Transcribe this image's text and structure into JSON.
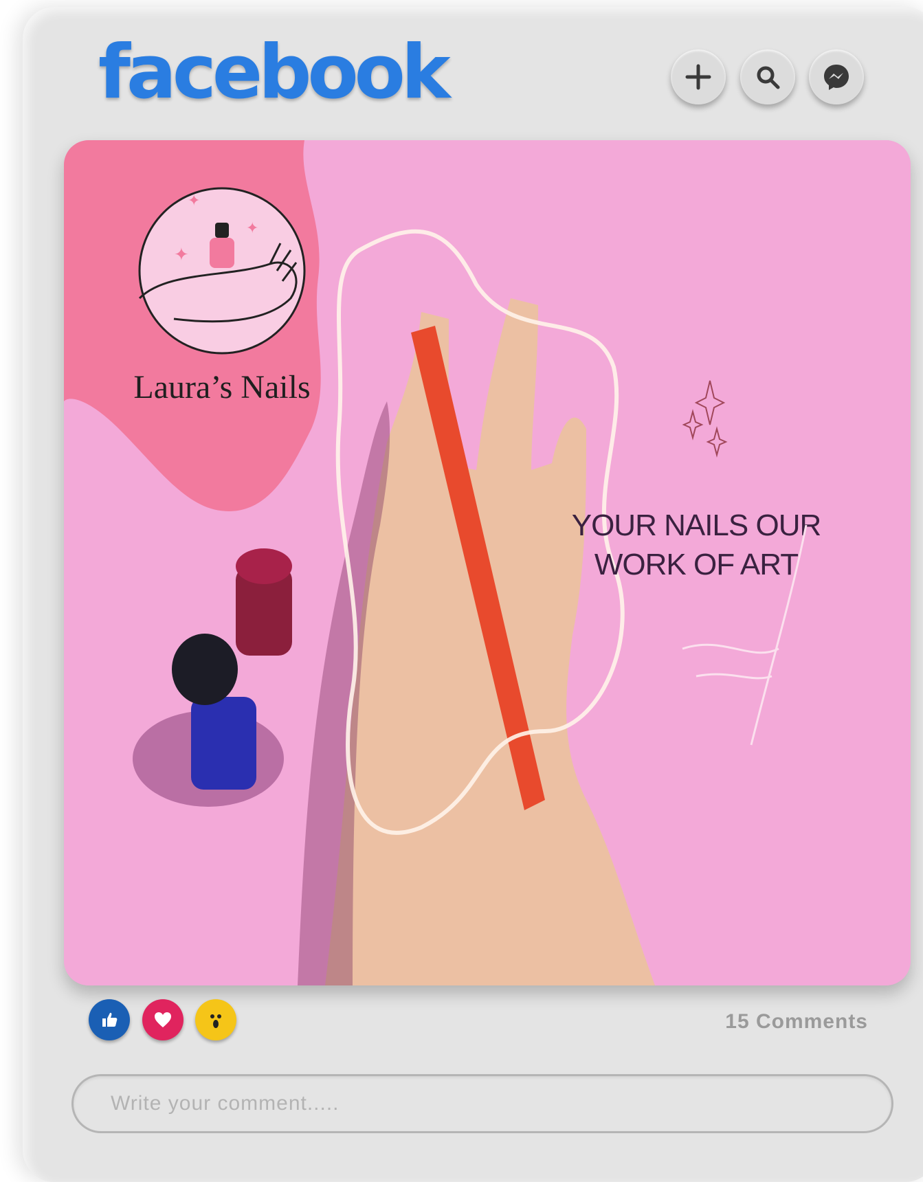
{
  "app": {
    "brand": "facebook",
    "brand_color": "#2a7de1"
  },
  "header": {
    "buttons": [
      {
        "icon": "plus-icon"
      },
      {
        "icon": "search-icon"
      },
      {
        "icon": "messenger-icon"
      }
    ]
  },
  "post": {
    "logo_text": "Laura’s Nails",
    "tagline_line1": "YOUR NAILS OUR",
    "tagline_line2": "WORK OF ART",
    "colors": {
      "background_pink": "#f3a9d8",
      "blob_pink": "#f27a9e",
      "logo_circle": "#f9cde3"
    }
  },
  "reactions": [
    {
      "icon": "like-icon",
      "color": "#1a5fb4"
    },
    {
      "icon": "love-icon",
      "color": "#e0245e"
    },
    {
      "icon": "wow-icon",
      "color": "#f5c518"
    }
  ],
  "comments": {
    "count_label": "15 Comments",
    "input_placeholder": "Write your comment....."
  }
}
